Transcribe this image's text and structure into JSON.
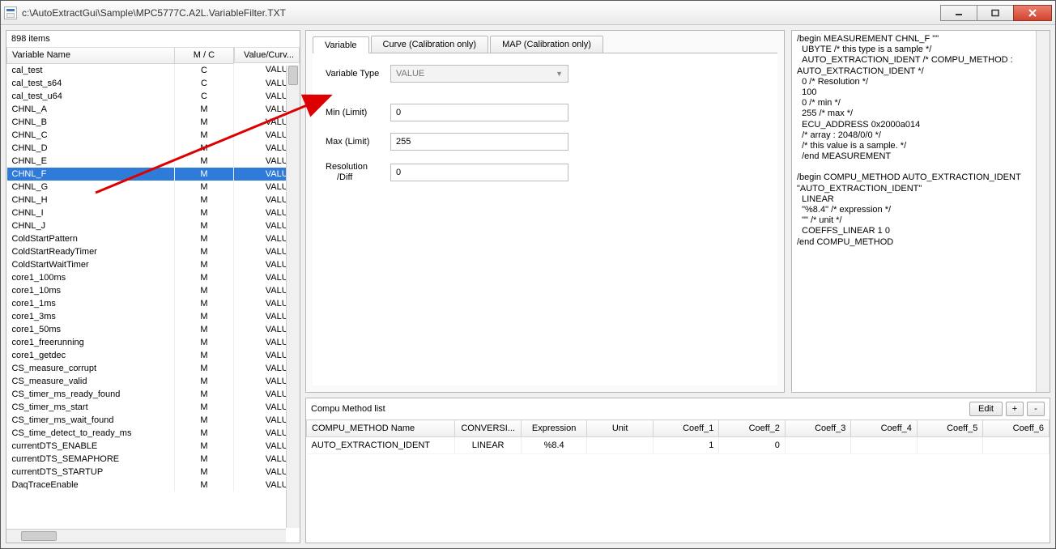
{
  "window": {
    "title": "c:\\AutoExtractGui\\Sample\\MPC5777C.A2L.VariableFilter.TXT"
  },
  "left": {
    "item_count_label": "898 items",
    "columns": {
      "name": "Variable Name",
      "mc": "M / C",
      "value": "Value/Curv..."
    },
    "rows": [
      {
        "name": "cal_test",
        "mc": "C",
        "value": "VALUE",
        "selected": false
      },
      {
        "name": "cal_test_s64",
        "mc": "C",
        "value": "VALUE",
        "selected": false
      },
      {
        "name": "cal_test_u64",
        "mc": "C",
        "value": "VALUE",
        "selected": false
      },
      {
        "name": "CHNL_A",
        "mc": "M",
        "value": "VALUE",
        "selected": false
      },
      {
        "name": "CHNL_B",
        "mc": "M",
        "value": "VALUE",
        "selected": false
      },
      {
        "name": "CHNL_C",
        "mc": "M",
        "value": "VALUE",
        "selected": false
      },
      {
        "name": "CHNL_D",
        "mc": "M",
        "value": "VALUE",
        "selected": false
      },
      {
        "name": "CHNL_E",
        "mc": "M",
        "value": "VALUE",
        "selected": false
      },
      {
        "name": "CHNL_F",
        "mc": "M",
        "value": "VALUE",
        "selected": true
      },
      {
        "name": "CHNL_G",
        "mc": "M",
        "value": "VALUE",
        "selected": false
      },
      {
        "name": "CHNL_H",
        "mc": "M",
        "value": "VALUE",
        "selected": false
      },
      {
        "name": "CHNL_I",
        "mc": "M",
        "value": "VALUE",
        "selected": false
      },
      {
        "name": "CHNL_J",
        "mc": "M",
        "value": "VALUE",
        "selected": false
      },
      {
        "name": "ColdStartPattern",
        "mc": "M",
        "value": "VALUE",
        "selected": false
      },
      {
        "name": "ColdStartReadyTimer",
        "mc": "M",
        "value": "VALUE",
        "selected": false
      },
      {
        "name": "ColdStartWaitTimer",
        "mc": "M",
        "value": "VALUE",
        "selected": false
      },
      {
        "name": "core1_100ms",
        "mc": "M",
        "value": "VALUE",
        "selected": false
      },
      {
        "name": "core1_10ms",
        "mc": "M",
        "value": "VALUE",
        "selected": false
      },
      {
        "name": "core1_1ms",
        "mc": "M",
        "value": "VALUE",
        "selected": false
      },
      {
        "name": "core1_3ms",
        "mc": "M",
        "value": "VALUE",
        "selected": false
      },
      {
        "name": "core1_50ms",
        "mc": "M",
        "value": "VALUE",
        "selected": false
      },
      {
        "name": "core1_freerunning",
        "mc": "M",
        "value": "VALUE",
        "selected": false
      },
      {
        "name": "core1_getdec",
        "mc": "M",
        "value": "VALUE",
        "selected": false
      },
      {
        "name": "CS_measure_corrupt",
        "mc": "M",
        "value": "VALUE",
        "selected": false
      },
      {
        "name": "CS_measure_valid",
        "mc": "M",
        "value": "VALUE",
        "selected": false
      },
      {
        "name": "CS_timer_ms_ready_found",
        "mc": "M",
        "value": "VALUE",
        "selected": false
      },
      {
        "name": "CS_timer_ms_start",
        "mc": "M",
        "value": "VALUE",
        "selected": false
      },
      {
        "name": "CS_timer_ms_wait_found",
        "mc": "M",
        "value": "VALUE",
        "selected": false
      },
      {
        "name": "CS_time_detect_to_ready_ms",
        "mc": "M",
        "value": "VALUE",
        "selected": false
      },
      {
        "name": "currentDTS_ENABLE",
        "mc": "M",
        "value": "VALUE",
        "selected": false
      },
      {
        "name": "currentDTS_SEMAPHORE",
        "mc": "M",
        "value": "VALUE",
        "selected": false
      },
      {
        "name": "currentDTS_STARTUP",
        "mc": "M",
        "value": "VALUE",
        "selected": false
      },
      {
        "name": "DaqTraceEnable",
        "mc": "M",
        "value": "VALUE",
        "selected": false
      }
    ]
  },
  "tabs": {
    "variable": "Variable",
    "curve": "Curve (Calibration only)",
    "map": "MAP (Calibration only)"
  },
  "form": {
    "variable_type_label": "Variable Type",
    "variable_type_value": "VALUE",
    "min_label": "Min (Limit)",
    "min_value": "0",
    "max_label": "Max (Limit)",
    "max_value": "255",
    "res_label_l1": "Resolution",
    "res_label_l2": "/Diff",
    "res_value": "0"
  },
  "a2l_text": "/begin MEASUREMENT CHNL_F \"\"\n  UBYTE /* this type is a sample */\n  AUTO_EXTRACTION_IDENT /* COMPU_METHOD : AUTO_EXTRACTION_IDENT */\n  0 /* Resolution */\n  100\n  0 /* min */\n  255 /* max */\n  ECU_ADDRESS 0x2000a014\n  /* array : 2048/0/0 */\n  /* this value is a sample. */\n  /end MEASUREMENT\n\n/begin COMPU_METHOD AUTO_EXTRACTION_IDENT \"AUTO_EXTRACTION_IDENT\"\n  LINEAR\n  \"%8.4\" /* expression */\n  \"\" /* unit */\n  COEFFS_LINEAR 1 0\n/end COMPU_METHOD",
  "compu": {
    "title": "Compu Method list",
    "edit": "Edit",
    "plus": "+",
    "minus": "-",
    "headers": {
      "name": "COMPU_METHOD Name",
      "conv": "CONVERSI...",
      "expr": "Expression",
      "unit": "Unit",
      "c1": "Coeff_1",
      "c2": "Coeff_2",
      "c3": "Coeff_3",
      "c4": "Coeff_4",
      "c5": "Coeff_5",
      "c6": "Coeff_6"
    },
    "rows": [
      {
        "name": "AUTO_EXTRACTION_IDENT",
        "conv": "LINEAR",
        "expr": "%8.4",
        "unit": "",
        "c1": "1",
        "c2": "0",
        "c3": "",
        "c4": "",
        "c5": "",
        "c6": ""
      }
    ]
  }
}
